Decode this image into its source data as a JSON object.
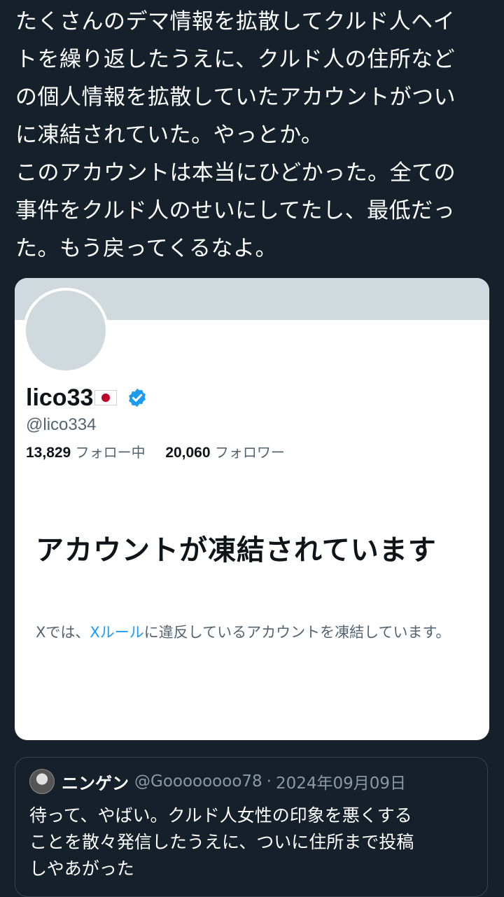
{
  "tweet": {
    "lines": [
      "たくさんのデマ情報を拡散してクルド人ヘイ",
      "トを繰り返したうえに、クルド人の住所など",
      "の個人情報を拡散していたアカウントがつい",
      "に凍結されていた。やっとか。",
      "このアカウントは本当にひどかった。全ての",
      "事件をクルド人のせいにしてたし、最低だっ",
      "た。もう戻ってくるなよ。"
    ]
  },
  "profile": {
    "display_name": "lico33",
    "flag_icon": "japan-flag-icon",
    "verified_icon": "verified-badge-icon",
    "handle": "@lico334",
    "following_count": "13,829",
    "following_label": "フォロー中",
    "followers_count": "20,060",
    "followers_label": "フォロワー"
  },
  "suspended": {
    "title": "アカウントが凍結されています",
    "desc_prefix": "Xでは、",
    "rules_link": "Xルール",
    "desc_suffix": "に違反しているアカウントを凍結しています。"
  },
  "quote": {
    "name": "ニンゲン",
    "handle": "@Goooooooo78",
    "separator": "·",
    "date": "2024年09月09日",
    "lines": [
      "待って、やばい。クルド人女性の印象を悪くする",
      "ことを散々発信したうえに、ついに住所まで投稿",
      "しやあがった"
    ]
  },
  "colors": {
    "background": "#15202b",
    "card": "#ffffff",
    "banner": "#cfd9de",
    "link": "#1d9bf0",
    "verified": "#1d9bf0",
    "secondary_text": "#536471"
  }
}
